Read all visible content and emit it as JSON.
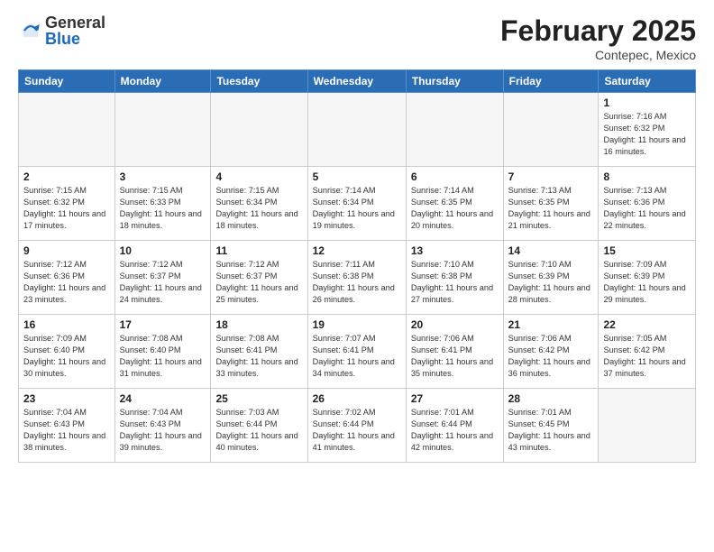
{
  "logo": {
    "general": "General",
    "blue": "Blue"
  },
  "title": "February 2025",
  "subtitle": "Contepec, Mexico",
  "weekdays": [
    "Sunday",
    "Monday",
    "Tuesday",
    "Wednesday",
    "Thursday",
    "Friday",
    "Saturday"
  ],
  "weeks": [
    [
      {
        "day": "",
        "info": ""
      },
      {
        "day": "",
        "info": ""
      },
      {
        "day": "",
        "info": ""
      },
      {
        "day": "",
        "info": ""
      },
      {
        "day": "",
        "info": ""
      },
      {
        "day": "",
        "info": ""
      },
      {
        "day": "1",
        "info": "Sunrise: 7:16 AM\nSunset: 6:32 PM\nDaylight: 11 hours and 16 minutes."
      }
    ],
    [
      {
        "day": "2",
        "info": "Sunrise: 7:15 AM\nSunset: 6:32 PM\nDaylight: 11 hours and 17 minutes."
      },
      {
        "day": "3",
        "info": "Sunrise: 7:15 AM\nSunset: 6:33 PM\nDaylight: 11 hours and 18 minutes."
      },
      {
        "day": "4",
        "info": "Sunrise: 7:15 AM\nSunset: 6:34 PM\nDaylight: 11 hours and 18 minutes."
      },
      {
        "day": "5",
        "info": "Sunrise: 7:14 AM\nSunset: 6:34 PM\nDaylight: 11 hours and 19 minutes."
      },
      {
        "day": "6",
        "info": "Sunrise: 7:14 AM\nSunset: 6:35 PM\nDaylight: 11 hours and 20 minutes."
      },
      {
        "day": "7",
        "info": "Sunrise: 7:13 AM\nSunset: 6:35 PM\nDaylight: 11 hours and 21 minutes."
      },
      {
        "day": "8",
        "info": "Sunrise: 7:13 AM\nSunset: 6:36 PM\nDaylight: 11 hours and 22 minutes."
      }
    ],
    [
      {
        "day": "9",
        "info": "Sunrise: 7:12 AM\nSunset: 6:36 PM\nDaylight: 11 hours and 23 minutes."
      },
      {
        "day": "10",
        "info": "Sunrise: 7:12 AM\nSunset: 6:37 PM\nDaylight: 11 hours and 24 minutes."
      },
      {
        "day": "11",
        "info": "Sunrise: 7:12 AM\nSunset: 6:37 PM\nDaylight: 11 hours and 25 minutes."
      },
      {
        "day": "12",
        "info": "Sunrise: 7:11 AM\nSunset: 6:38 PM\nDaylight: 11 hours and 26 minutes."
      },
      {
        "day": "13",
        "info": "Sunrise: 7:10 AM\nSunset: 6:38 PM\nDaylight: 11 hours and 27 minutes."
      },
      {
        "day": "14",
        "info": "Sunrise: 7:10 AM\nSunset: 6:39 PM\nDaylight: 11 hours and 28 minutes."
      },
      {
        "day": "15",
        "info": "Sunrise: 7:09 AM\nSunset: 6:39 PM\nDaylight: 11 hours and 29 minutes."
      }
    ],
    [
      {
        "day": "16",
        "info": "Sunrise: 7:09 AM\nSunset: 6:40 PM\nDaylight: 11 hours and 30 minutes."
      },
      {
        "day": "17",
        "info": "Sunrise: 7:08 AM\nSunset: 6:40 PM\nDaylight: 11 hours and 31 minutes."
      },
      {
        "day": "18",
        "info": "Sunrise: 7:08 AM\nSunset: 6:41 PM\nDaylight: 11 hours and 33 minutes."
      },
      {
        "day": "19",
        "info": "Sunrise: 7:07 AM\nSunset: 6:41 PM\nDaylight: 11 hours and 34 minutes."
      },
      {
        "day": "20",
        "info": "Sunrise: 7:06 AM\nSunset: 6:41 PM\nDaylight: 11 hours and 35 minutes."
      },
      {
        "day": "21",
        "info": "Sunrise: 7:06 AM\nSunset: 6:42 PM\nDaylight: 11 hours and 36 minutes."
      },
      {
        "day": "22",
        "info": "Sunrise: 7:05 AM\nSunset: 6:42 PM\nDaylight: 11 hours and 37 minutes."
      }
    ],
    [
      {
        "day": "23",
        "info": "Sunrise: 7:04 AM\nSunset: 6:43 PM\nDaylight: 11 hours and 38 minutes."
      },
      {
        "day": "24",
        "info": "Sunrise: 7:04 AM\nSunset: 6:43 PM\nDaylight: 11 hours and 39 minutes."
      },
      {
        "day": "25",
        "info": "Sunrise: 7:03 AM\nSunset: 6:44 PM\nDaylight: 11 hours and 40 minutes."
      },
      {
        "day": "26",
        "info": "Sunrise: 7:02 AM\nSunset: 6:44 PM\nDaylight: 11 hours and 41 minutes."
      },
      {
        "day": "27",
        "info": "Sunrise: 7:01 AM\nSunset: 6:44 PM\nDaylight: 11 hours and 42 minutes."
      },
      {
        "day": "28",
        "info": "Sunrise: 7:01 AM\nSunset: 6:45 PM\nDaylight: 11 hours and 43 minutes."
      },
      {
        "day": "",
        "info": ""
      }
    ]
  ]
}
